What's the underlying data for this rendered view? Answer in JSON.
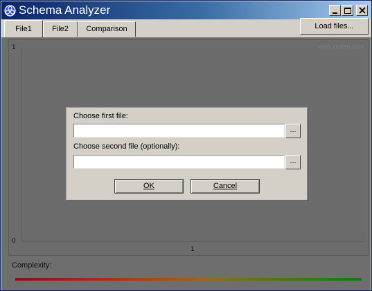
{
  "window": {
    "title": "Schema Analyzer",
    "controls": {
      "minimize": "minimize-icon",
      "maximize": "maximize-icon",
      "close": "close-icon"
    }
  },
  "tabs": [
    {
      "label": "File1",
      "active": true
    },
    {
      "label": "File2",
      "active": false
    },
    {
      "label": "Comparison",
      "active": false
    }
  ],
  "toolbar": {
    "load_files_label": "Load files..."
  },
  "chart": {
    "y_tick_top": "1",
    "y_tick_bottom": "0",
    "x_tick": "1",
    "watermark": "www.visifire.com"
  },
  "complexity": {
    "label": "Complexity:",
    "gradient_colors": [
      "#8a1010",
      "#b0281a",
      "#9a6a18",
      "#3c7a18",
      "#117a10"
    ]
  },
  "dialog": {
    "first_file_label": "Choose first file:",
    "first_file_value": "",
    "second_file_label": "Choose second file (optionally):",
    "second_file_value": "",
    "browse_label": "...",
    "ok_label": "OK",
    "cancel_label": "Cancel"
  },
  "colors": {
    "titlebar_start": "#0a246a",
    "titlebar_end": "#a6caf0",
    "face": "#d4d0c8",
    "overlay": "#6e6e6e"
  }
}
